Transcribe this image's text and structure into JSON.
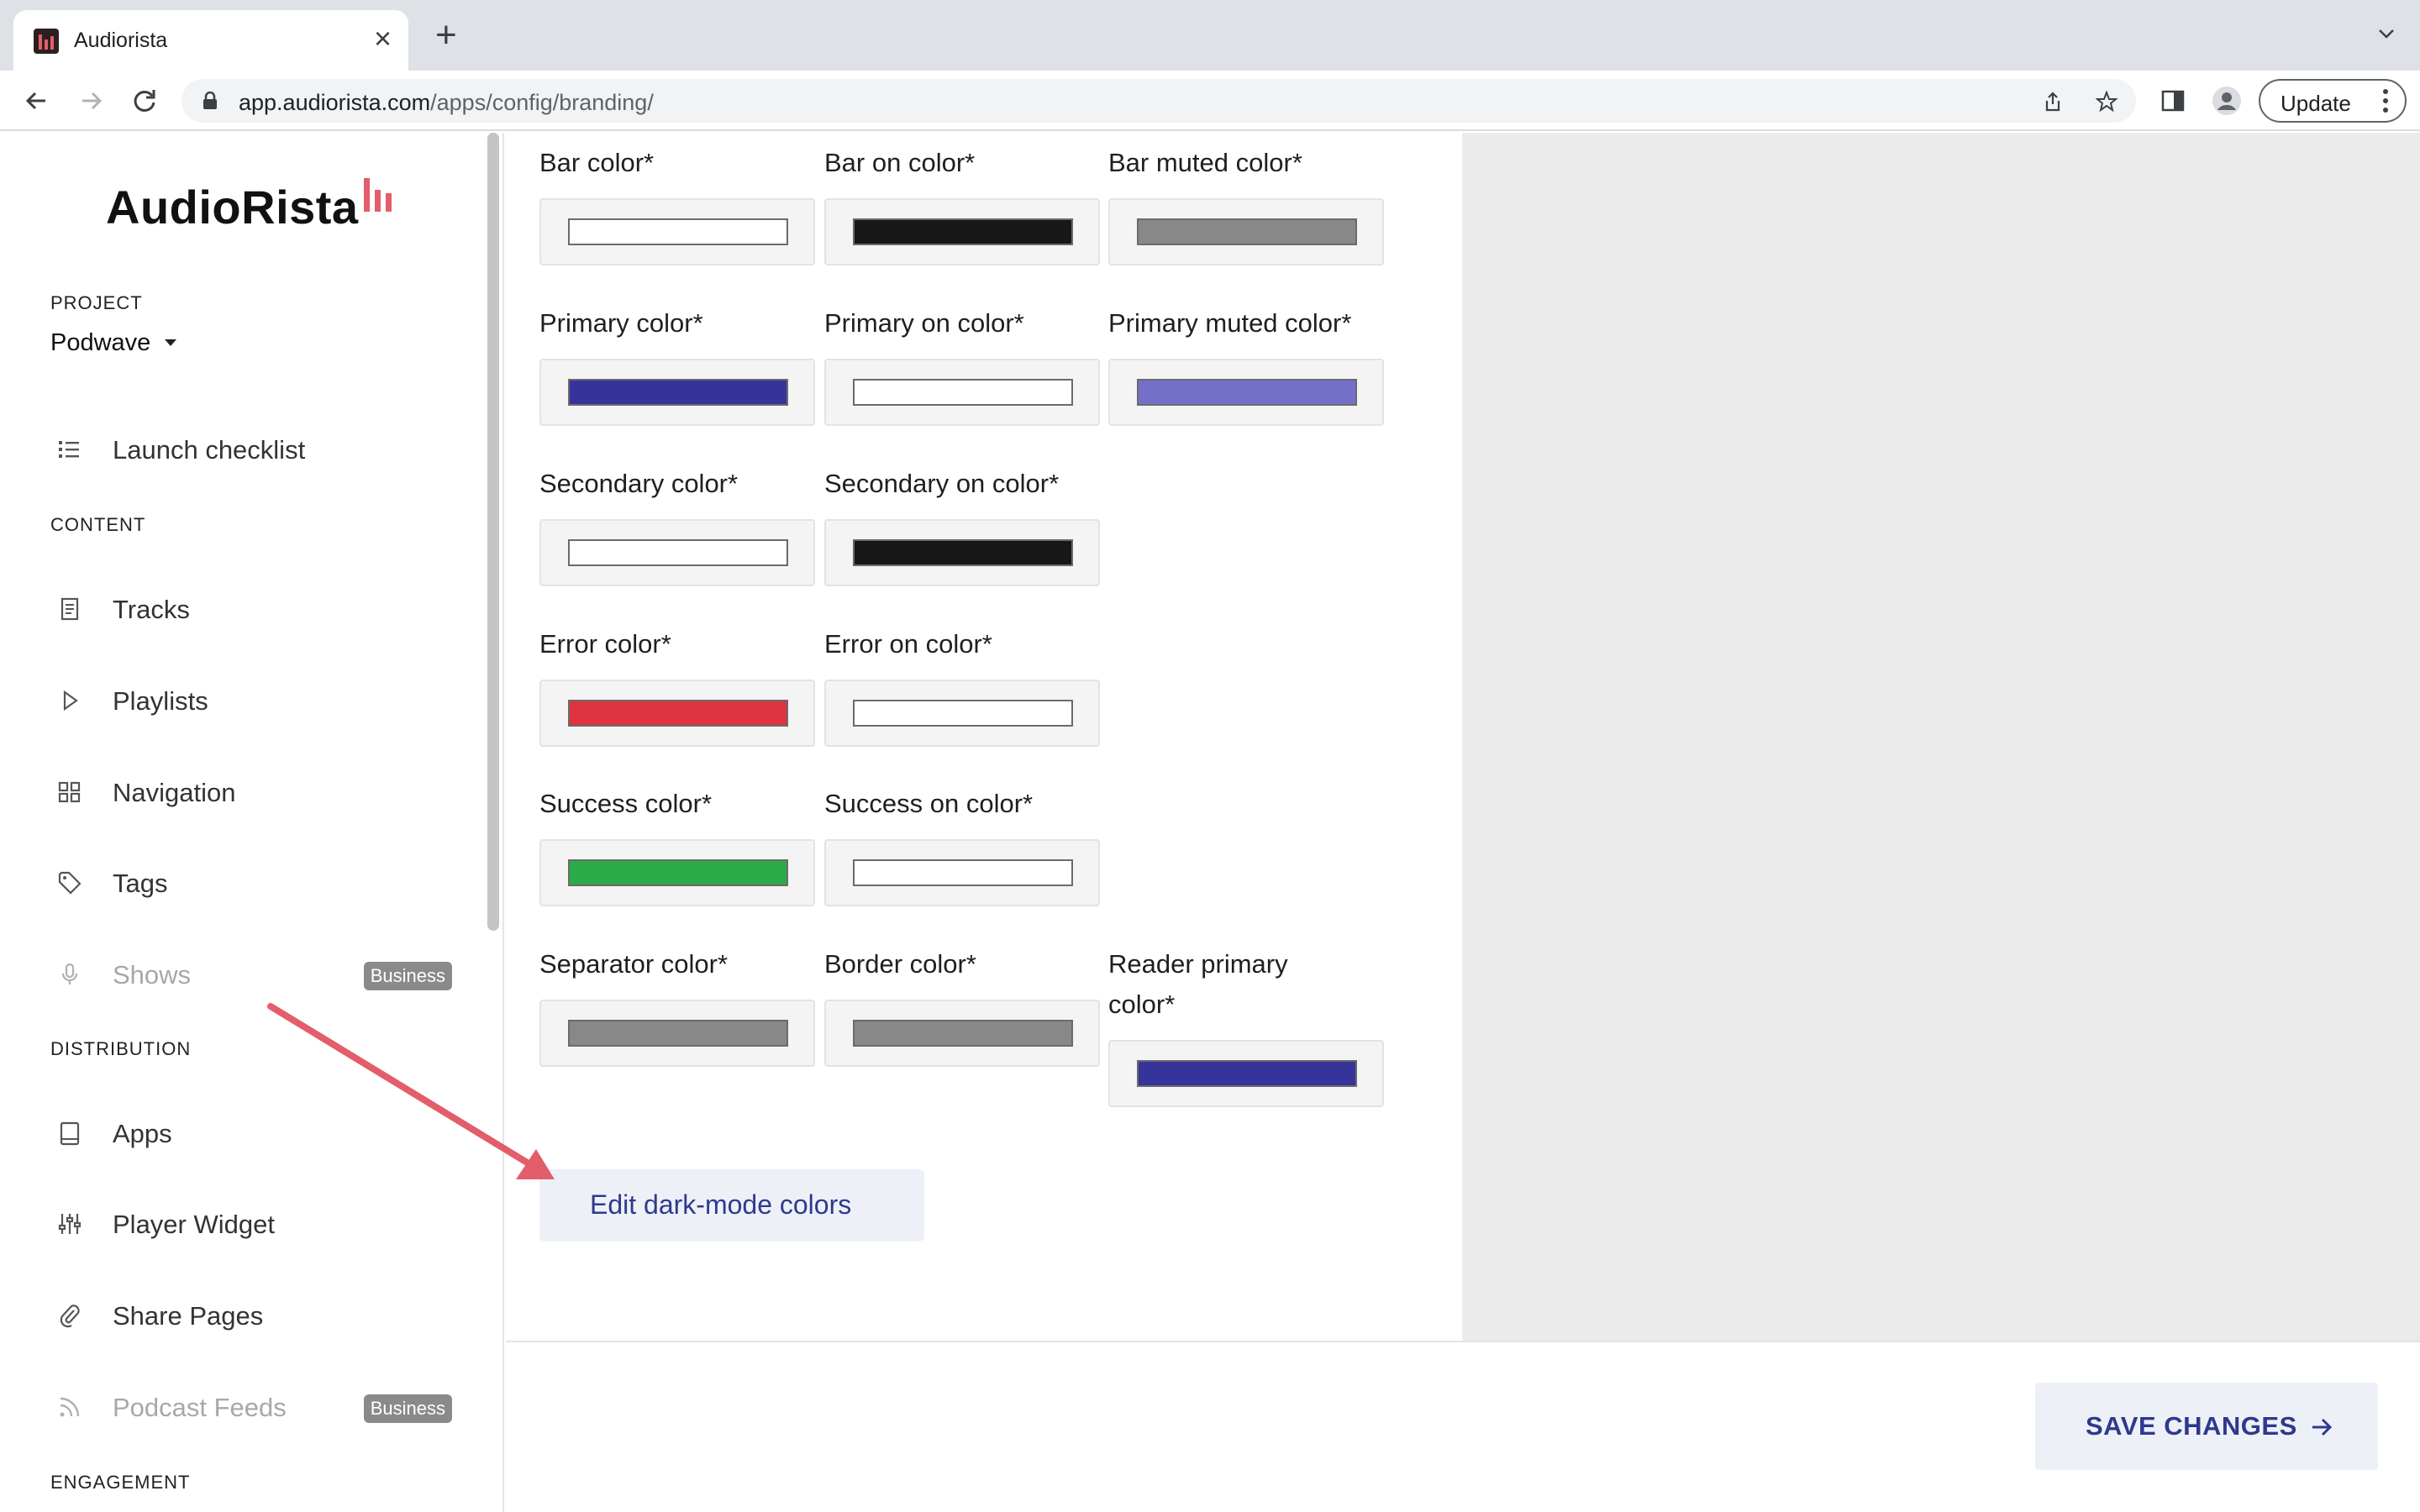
{
  "browser": {
    "tab_title": "Audiorista",
    "url_host": "app.audiorista.com",
    "url_path": "/apps/config/branding/",
    "update_label": "Update"
  },
  "sidebar": {
    "logo": "AudioRista",
    "project_label": "PROJECT",
    "project_name": "Podwave",
    "launch_checklist": "Launch checklist",
    "content_label": "CONTENT",
    "content_items": [
      {
        "label": "Tracks"
      },
      {
        "label": "Playlists"
      },
      {
        "label": "Navigation"
      },
      {
        "label": "Tags"
      },
      {
        "label": "Shows",
        "badge": "Business"
      }
    ],
    "distribution_label": "DISTRIBUTION",
    "distribution_items": [
      {
        "label": "Apps"
      },
      {
        "label": "Player Widget"
      },
      {
        "label": "Share Pages"
      },
      {
        "label": "Podcast Feeds",
        "badge": "Business"
      }
    ],
    "engagement_label": "ENGAGEMENT"
  },
  "colors": {
    "bar_color": {
      "label": "Bar color*",
      "value": "#ffffff"
    },
    "bar_on_color": {
      "label": "Bar on color*",
      "value": "#171717"
    },
    "bar_muted_color": {
      "label": "Bar muted color*",
      "value": "#888888"
    },
    "primary_color": {
      "label": "Primary color*",
      "value": "#36339a"
    },
    "primary_on_color": {
      "label": "Primary on color*",
      "value": "#ffffff"
    },
    "primary_muted_color": {
      "label": "Primary muted color*",
      "value": "#7470c9"
    },
    "secondary_color": {
      "label": "Secondary color*",
      "value": "#ffffff"
    },
    "secondary_on_color": {
      "label": "Secondary on color*",
      "value": "#171717"
    },
    "error_color": {
      "label": "Error color*",
      "value": "#df3341"
    },
    "error_on_color": {
      "label": "Error on color*",
      "value": "#ffffff"
    },
    "success_color": {
      "label": "Success color*",
      "value": "#2aab48"
    },
    "success_on_color": {
      "label": "Success on color*",
      "value": "#ffffff"
    },
    "separator_color": {
      "label": "Separator color*",
      "value": "#888888"
    },
    "border_color": {
      "label": "Border color*",
      "value": "#888888"
    },
    "reader_primary_color": {
      "label": "Reader primary color*",
      "value": "#36339a"
    }
  },
  "actions": {
    "edit_dark_mode": "Edit dark-mode colors",
    "save_changes": "SAVE CHANGES"
  },
  "theme": {
    "accent": "#2d3a8c",
    "brand_red": "#e35d6a",
    "annotation_arrow": "#e35d6a"
  }
}
